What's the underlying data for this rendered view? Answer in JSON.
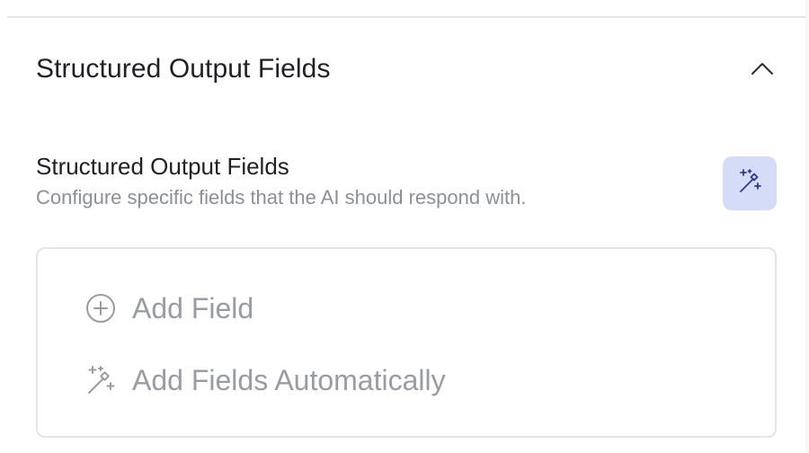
{
  "section": {
    "title": "Structured Output Fields",
    "collapse_icon": "chevron-up-icon"
  },
  "field": {
    "label": "Structured Output Fields",
    "description": "Configure specific fields that the AI should respond with.",
    "magic_icon": "magic-wand-icon"
  },
  "actions": {
    "add_field_label": "Add Field",
    "add_field_icon": "plus-circle-icon",
    "auto_label": "Add Fields Automatically",
    "auto_icon": "magic-wand-icon"
  },
  "colors": {
    "accent_bg": "#d5dcf7",
    "accent_icon": "#2f3a8c",
    "muted_text": "#9a9ca4"
  }
}
